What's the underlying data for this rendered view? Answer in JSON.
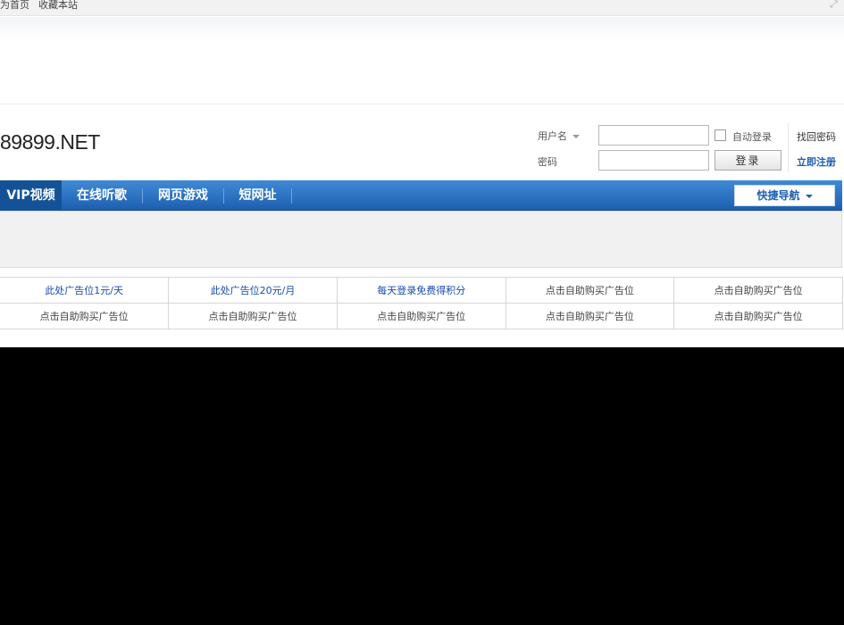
{
  "topbar": {
    "home_link": "为首页",
    "bookmark_link": "收藏本站"
  },
  "logo": {
    "text": "89899.NET"
  },
  "login": {
    "username_label": "用户名",
    "password_label": "密码",
    "username_value": "",
    "password_value": "",
    "auto_login_label": "自动登录",
    "login_button": "登录",
    "forgot_password": "找回密码",
    "register": "立即注册"
  },
  "nav": {
    "items": [
      {
        "label": "VIP视频"
      },
      {
        "label": "在线听歌"
      },
      {
        "label": "网页游戏"
      },
      {
        "label": "短网址"
      }
    ],
    "quick_nav": "快捷导航"
  },
  "ads": {
    "row1": [
      "此处广告位1元/天",
      "此处广告位20元/月",
      "每天登录免费得积分",
      "点击自助购买广告位",
      "点击自助购买广告位"
    ],
    "row2": [
      "点击自助购买广告位",
      "点击自助购买广告位",
      "点击自助购买广告位",
      "点击自助购买广告位",
      "点击自助购买广告位"
    ]
  },
  "colors": {
    "nav_blue": "#2a6fc4",
    "link_blue": "#1a5fb4"
  }
}
